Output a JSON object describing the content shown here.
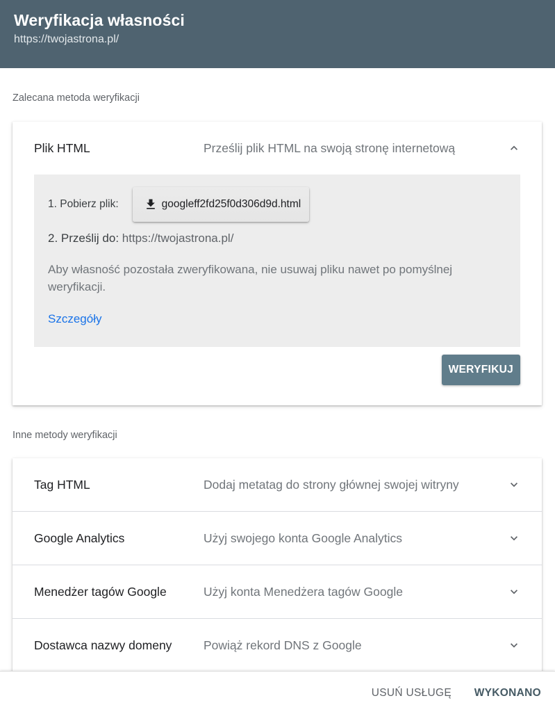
{
  "header": {
    "title": "Weryfikacja własności",
    "url": "https://twojastrona.pl/"
  },
  "recommended": {
    "label": "Zalecana metoda weryfikacji",
    "method": {
      "title": "Plik HTML",
      "description": "Prześlij plik HTML na swoją stronę internetową",
      "step1_label": "1. Pobierz plik:",
      "file_name": "googleff2fd25f0d306d9d.html",
      "step2_label": "2. Prześlij do:",
      "step2_url": "https://twojastrona.pl/",
      "note": "Aby własność pozostała zweryfikowana, nie usuwaj pliku nawet po pomyślnej weryfikacji.",
      "details_link": "Szczegóły",
      "verify_button": "WERYFIKUJ"
    }
  },
  "other": {
    "label": "Inne metody weryfikacji",
    "methods": [
      {
        "title": "Tag HTML",
        "description": "Dodaj metatag do strony głównej swojej witryny"
      },
      {
        "title": "Google Analytics",
        "description": "Użyj swojego konta Google Analytics"
      },
      {
        "title": "Menedżer tagów Google",
        "description": "Użyj konta Menedżera tagów Google"
      },
      {
        "title": "Dostawca nazwy domeny",
        "description": "Powiąż rekord DNS z Google"
      }
    ]
  },
  "footer": {
    "remove_button": "USUŃ USŁUGĘ",
    "done_button": "WYKONANO"
  },
  "colors": {
    "header_bg": "#4f6370",
    "verify_button_bg": "#607d8b",
    "link": "#1a73e8"
  }
}
